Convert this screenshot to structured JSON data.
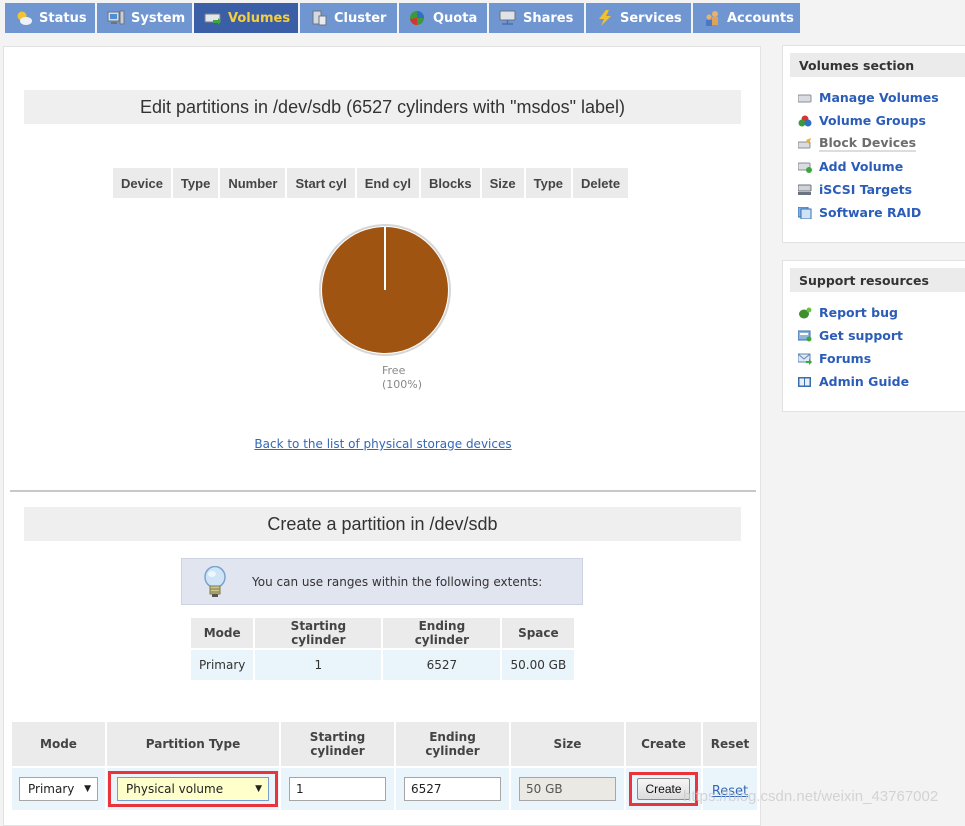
{
  "tabs": [
    {
      "label": "Status",
      "icon": "weather-sun-cloud-icon",
      "active": false
    },
    {
      "label": "System",
      "icon": "computer-icon",
      "active": false
    },
    {
      "label": "Volumes",
      "icon": "drive-icon",
      "active": true
    },
    {
      "label": "Cluster",
      "icon": "cluster-icon",
      "active": false
    },
    {
      "label": "Quota",
      "icon": "pie-quota-icon",
      "active": false
    },
    {
      "label": "Shares",
      "icon": "network-share-icon",
      "active": false
    },
    {
      "label": "Services",
      "icon": "lightning-icon",
      "active": false
    },
    {
      "label": "Accounts",
      "icon": "users-icon",
      "active": false
    }
  ],
  "edit_section": {
    "title": "Edit partitions in /dev/sdb (6527 cylinders with \"msdos\" label)",
    "columns": [
      "Device",
      "Type",
      "Number",
      "Start cyl",
      "End cyl",
      "Blocks",
      "Size",
      "Type",
      "Delete"
    ],
    "back_link": "Back to the list of physical storage devices"
  },
  "chart_data": {
    "type": "pie",
    "title": "",
    "slices": [
      {
        "label": "Free",
        "value": 100,
        "display": "(100%)",
        "color": "#a05412"
      }
    ]
  },
  "create_section": {
    "title": "Create a partition in /dev/sdb",
    "hint": "You can use ranges within the following extents:",
    "extents_columns": [
      "Mode",
      "Starting cylinder",
      "Ending cylinder",
      "Space"
    ],
    "extents_rows": [
      {
        "mode": "Primary",
        "start": "1",
        "end": "6527",
        "space": "50.00 GB"
      }
    ]
  },
  "form": {
    "columns": {
      "mode": "Mode",
      "partition_type": "Partition Type",
      "starting_cylinder_1": "Starting",
      "starting_cylinder_2": "cylinder",
      "ending_cylinder_1": "Ending",
      "ending_cylinder_2": "cylinder",
      "size": "Size",
      "create": "Create",
      "reset": "Reset"
    },
    "mode_value": "Primary",
    "partition_type_value": "Physical volume",
    "starting_cylinder_value": "1",
    "ending_cylinder_value": "6527",
    "size_value": "50 GB",
    "create_button": "Create",
    "reset_link": "Reset"
  },
  "sidebar": {
    "volumes": {
      "title": "Volumes section",
      "items": [
        {
          "label": "Manage Volumes",
          "icon": "drive-icon",
          "current": false
        },
        {
          "label": "Volume Groups",
          "icon": "volume-groups-icon",
          "current": false
        },
        {
          "label": "Block Devices",
          "icon": "block-device-icon",
          "current": true
        },
        {
          "label": "Add Volume",
          "icon": "add-volume-icon",
          "current": false
        },
        {
          "label": "iSCSI Targets",
          "icon": "iscsi-icon",
          "current": false
        },
        {
          "label": "Software RAID",
          "icon": "raid-icon",
          "current": false
        }
      ]
    },
    "support": {
      "title": "Support resources",
      "items": [
        {
          "label": "Report bug",
          "icon": "bug-icon"
        },
        {
          "label": "Get support",
          "icon": "support-icon"
        },
        {
          "label": "Forums",
          "icon": "forums-mail-icon"
        },
        {
          "label": "Admin Guide",
          "icon": "book-icon"
        }
      ]
    }
  },
  "watermark": "https://blog.csdn.net/weixin_43767002"
}
